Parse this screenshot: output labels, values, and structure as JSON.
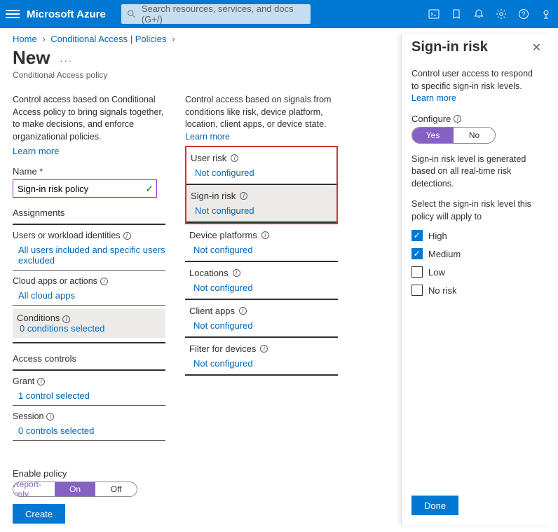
{
  "topbar": {
    "brand": "Microsoft Azure",
    "search_placeholder": "Search resources, services, and docs (G+/)"
  },
  "breadcrumb": {
    "home": "Home",
    "item1": "Conditional Access | Policies"
  },
  "heading": {
    "title": "New",
    "subtitle": "Conditional Access policy"
  },
  "left": {
    "intro": "Control access based on Conditional Access policy to bring signals together, to make decisions, and enforce organizational policies.",
    "learn_more": "Learn more",
    "name_label": "Name",
    "name_value": "Sign-in risk policy",
    "assignments_hdr": "Assignments",
    "users_label": "Users or workload identities",
    "users_value": "All users included and specific users excluded",
    "apps_label": "Cloud apps or actions",
    "apps_value": "All cloud apps",
    "conditions_label": "Conditions",
    "conditions_value": "0 conditions selected",
    "access_hdr": "Access controls",
    "grant_label": "Grant",
    "grant_value": "1 control selected",
    "session_label": "Session",
    "session_value": "0 controls selected"
  },
  "mid": {
    "intro": "Control access based on signals from conditions like risk, device platform, location, client apps, or device state.",
    "learn_more": "Learn more",
    "rows": {
      "user_risk": {
        "label": "User risk",
        "value": "Not configured"
      },
      "signin_risk": {
        "label": "Sign-in risk",
        "value": "Not configured"
      },
      "device_platforms": {
        "label": "Device platforms",
        "value": "Not configured"
      },
      "locations": {
        "label": "Locations",
        "value": "Not configured"
      },
      "client_apps": {
        "label": "Client apps",
        "value": "Not configured"
      },
      "filter": {
        "label": "Filter for devices",
        "value": "Not configured"
      }
    }
  },
  "panel": {
    "title": "Sign-in risk",
    "desc": "Control user access to respond to specific sign-in risk levels.",
    "learn_more": "Learn more",
    "configure_label": "Configure",
    "yes": "Yes",
    "no": "No",
    "detect_text": "Sign-in risk level is generated based on all real-time risk detections.",
    "select_text": "Select the sign-in risk level this policy will apply to",
    "opts": {
      "high": "High",
      "medium": "Medium",
      "low": "Low",
      "norisk": "No risk"
    },
    "done": "Done"
  },
  "footer": {
    "enable_label": "Enable policy",
    "report_only": "Report-only",
    "on": "On",
    "off": "Off",
    "create": "Create"
  }
}
